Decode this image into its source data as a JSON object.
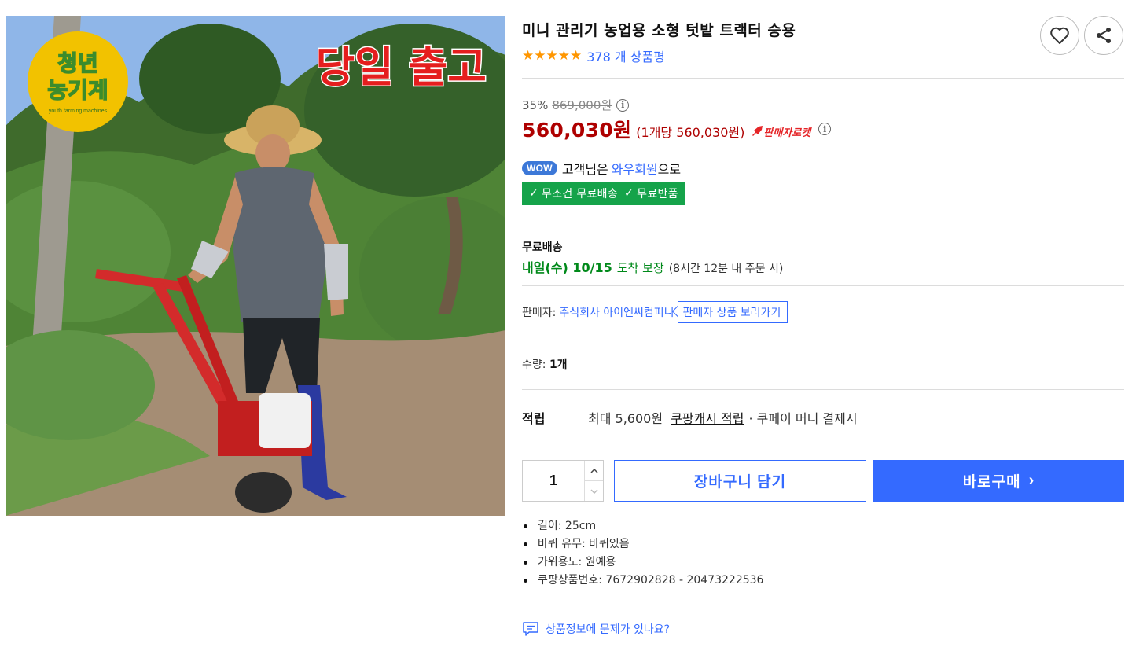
{
  "image": {
    "badge_line1": "청년",
    "badge_line2": "농기계",
    "badge_sub": "youth farming machines",
    "headline": "당일 출고"
  },
  "product": {
    "title": "미니 관리기 농업용 소형 텃밭 트랙터 승용",
    "rating_stars": 5,
    "review_count": "378 개 상품평"
  },
  "price": {
    "discount": "35%",
    "original": "869,000원",
    "current": "560,030원",
    "unit": "(1개당 560,030원)",
    "rocket_label": "판매자로켓"
  },
  "wow": {
    "badge": "WOW",
    "text_prefix": "고객님은",
    "member": "와우회원",
    "text_suffix": "으로",
    "benefit1": "무조건 무료배송",
    "benefit2": "무료반품",
    "check": "✓"
  },
  "shipping": {
    "label": "무료배송",
    "arrival": "내일(수) 10/15",
    "guarantee": "도착 보장",
    "cutoff": "(8시간 12분 내 주문 시)"
  },
  "seller": {
    "label": "판매자:",
    "name": "주식회사 아이엔씨컴퍼니",
    "link": "판매자 상품 보러가기"
  },
  "quantity": {
    "label": "수량:",
    "value": "1개",
    "input_value": "1"
  },
  "points": {
    "label": "적립",
    "max": "최대 5,600원",
    "cash": "쿠팡캐시 적립",
    "extra": "· 쿠페이 머니 결제시"
  },
  "buttons": {
    "cart": "장바구니 담기",
    "buy": "바로구매",
    "buy_arrow": "›"
  },
  "attributes": [
    "길이: 25cm",
    "바퀴 유무: 바퀴있음",
    "가위용도: 원예용",
    "쿠팡상품번호: 7672902828 - 20473222536"
  ],
  "report": "상품정보에 문제가 있나요?",
  "colors": {
    "accent_blue": "#346aff",
    "price_red": "#ae0000",
    "rocket_red": "#e52528",
    "arrival_green": "#00891a",
    "wow_green": "#15a34a",
    "star_orange": "#ff9600"
  }
}
